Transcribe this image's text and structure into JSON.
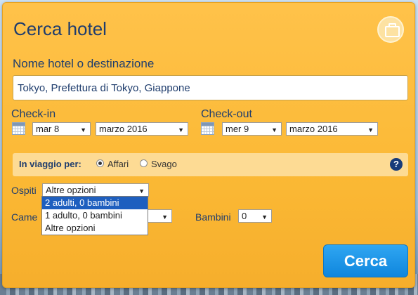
{
  "form": {
    "title": "Cerca hotel",
    "destination_label": "Nome hotel o destinazione",
    "destination_value": "Tokyo, Prefettura di Tokyo, Giappone",
    "checkin": {
      "label": "Check-in",
      "day": "mar 8",
      "month": "marzo 2016"
    },
    "checkout": {
      "label": "Check-out",
      "day": "mer 9",
      "month": "marzo 2016"
    },
    "travel": {
      "label": "In viaggio per:",
      "option1": "Affari",
      "option2": "Svago",
      "selected": "Affari"
    },
    "guests": {
      "label": "Ospiti",
      "value": "Altre opzioni",
      "options": [
        "2 adulti, 0 bambini",
        "1 adulto, 0 bambini",
        "Altre opzioni"
      ],
      "highlighted": "2 adulti, 0 bambini"
    },
    "rooms_label_visible": "Came",
    "children": {
      "label": "Bambini",
      "value": "0"
    },
    "submit_label": "Cerca"
  },
  "icons": {
    "suitcase": "suitcase-icon",
    "calendar": "calendar-icon",
    "help": "help-icon",
    "dropdown_arrow": "chevron-down-icon"
  },
  "help_glyph": "?",
  "colors": {
    "panel": "#fbb935",
    "title": "#1f3d6d",
    "button": "#1a94e8",
    "highlight": "#1e5fbf"
  }
}
